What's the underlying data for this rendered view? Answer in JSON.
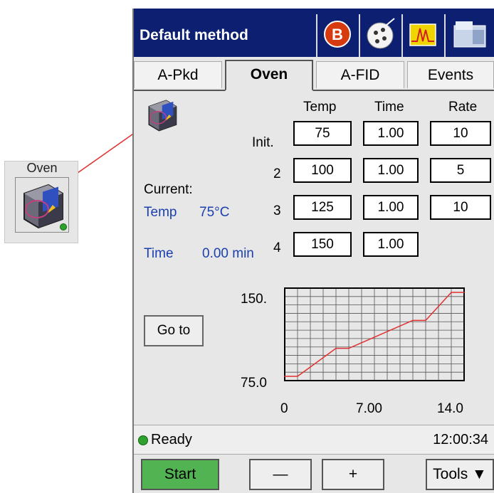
{
  "module": {
    "title": "Oven"
  },
  "header": {
    "title": "Default method",
    "icons": [
      "b-icon",
      "plate-icon",
      "chromatogram-icon",
      "instrument-icon"
    ]
  },
  "tabs": [
    {
      "label": "A-Pkd",
      "active": false
    },
    {
      "label": "Oven",
      "active": true
    },
    {
      "label": "A-FID",
      "active": false
    },
    {
      "label": "Events",
      "active": false
    }
  ],
  "table": {
    "headers": {
      "temp": "Temp",
      "time": "Time",
      "rate": "Rate"
    },
    "rows": [
      {
        "label": "Init.",
        "temp": "75",
        "time": "1.00",
        "rate": "10"
      },
      {
        "label": "2",
        "temp": "100",
        "time": "1.00",
        "rate": "5"
      },
      {
        "label": "3",
        "temp": "125",
        "time": "1.00",
        "rate": "10"
      },
      {
        "label": "4",
        "temp": "150",
        "time": "1.00"
      }
    ]
  },
  "current": {
    "heading": "Current:",
    "temp_label": "Temp",
    "temp_value": "75°C",
    "time_label": "Time",
    "time_value": "0.00 min"
  },
  "goto_label": "Go to",
  "chart_data": {
    "type": "line",
    "x": [
      0,
      1,
      4,
      5,
      7,
      10,
      11,
      13,
      14
    ],
    "y": [
      75,
      75,
      100,
      100,
      110,
      125,
      125,
      150,
      150
    ],
    "xlim": [
      0,
      14
    ],
    "ylim": [
      75,
      150
    ],
    "y_tick_labels": [
      "150.",
      "75.0"
    ],
    "x_tick_labels": [
      "0",
      "7.00",
      "14.0"
    ],
    "grid": true,
    "color": "#e03030"
  },
  "status": {
    "text": "Ready",
    "clock": "12:00:34"
  },
  "buttons": {
    "start": "Start",
    "minus": "—",
    "plus": "+",
    "tools": "Tools ▼"
  },
  "colors": {
    "titlebar": "#0c1f70",
    "start": "#52b352",
    "status_dot": "#2fa12f",
    "line": "#e03030"
  }
}
